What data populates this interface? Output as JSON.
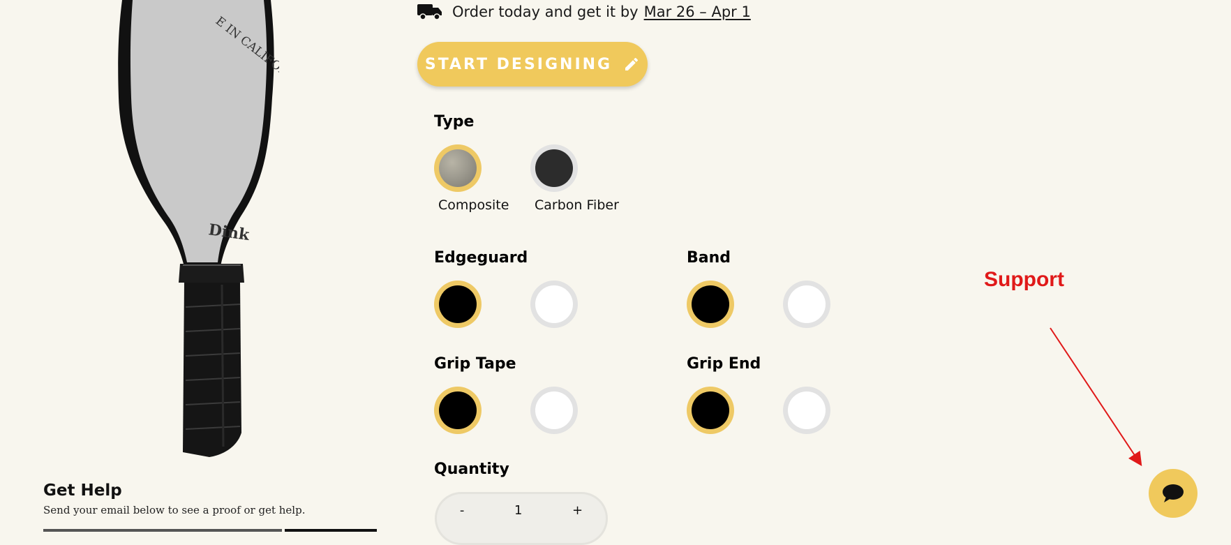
{
  "delivery": {
    "icon": "truck-icon",
    "text": "Order today and get it by",
    "date": "Mar 26 – Apr 1"
  },
  "cta": {
    "label": "START DESIGNING",
    "icon": "pencil-icon",
    "color": "#f0c95c"
  },
  "paddle": {
    "face_text": "E IN CALIFORNIA",
    "brand": "Dink"
  },
  "type": {
    "title": "Type",
    "options": [
      {
        "label": "Composite",
        "selected": true
      },
      {
        "label": "Carbon Fiber",
        "selected": false
      }
    ]
  },
  "edgeguard": {
    "title": "Edgeguard",
    "options": [
      "black",
      "white"
    ],
    "selected": "black"
  },
  "band": {
    "title": "Band",
    "options": [
      "black",
      "white"
    ],
    "selected": "black"
  },
  "grip_tape": {
    "title": "Grip Tape",
    "options": [
      "black",
      "white"
    ],
    "selected": "black"
  },
  "grip_end": {
    "title": "Grip End",
    "options": [
      "black",
      "white"
    ],
    "selected": "black"
  },
  "quantity": {
    "title": "Quantity",
    "minus": "-",
    "value": "1",
    "plus": "+"
  },
  "help": {
    "title": "Get Help",
    "subtitle": "Send your email below to see a proof or get help."
  },
  "support": {
    "label": "Support",
    "arrow_color": "#e01919",
    "chat_icon": "chat-bubble-icon"
  },
  "colors": {
    "background": "#f8f6ee",
    "accent": "#f0c95c",
    "selected_ring": "#eec965"
  }
}
